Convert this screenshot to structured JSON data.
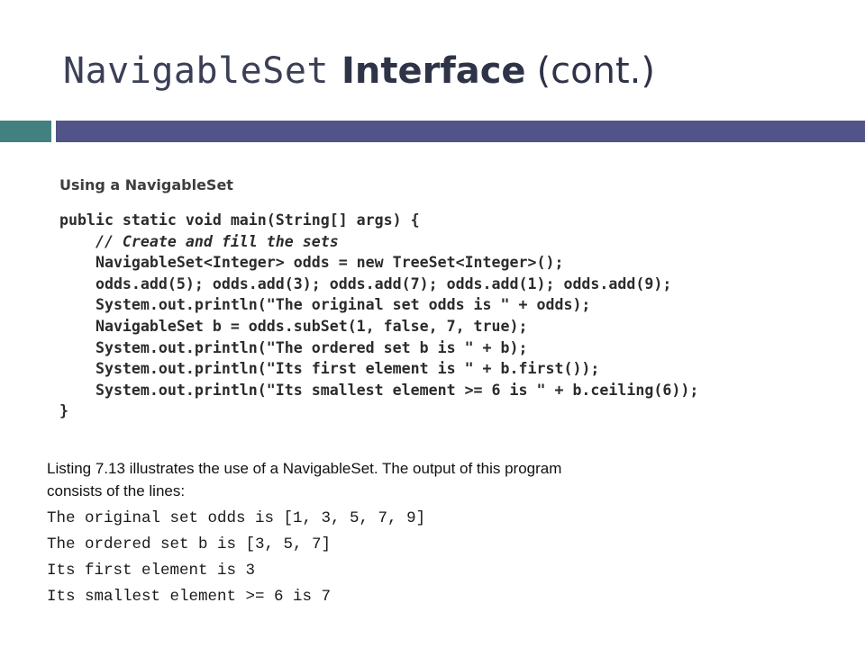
{
  "slide": {
    "title": {
      "mono_part": "NavigableSet",
      "bold_part": "Interface",
      "rest_part": "(cont.)"
    },
    "colors": {
      "title_text": "#3b3f56",
      "rule_teal": "#42817f",
      "rule_purple": "#515389",
      "code_text": "#2b2b2b",
      "body_text": "#111111"
    }
  },
  "figure": {
    "caption": "Using a NavigableSet",
    "code_lines": [
      {
        "text": "public static void main(String[] args) {",
        "comment": false
      },
      {
        "text": "    // Create and fill the sets",
        "comment": true
      },
      {
        "text": "    NavigableSet<Integer> odds = new TreeSet<Integer>();",
        "comment": false
      },
      {
        "text": "    odds.add(5); odds.add(3); odds.add(7); odds.add(1); odds.add(9);",
        "comment": false
      },
      {
        "text": "    System.out.println(\"The original set odds is \" + odds);",
        "comment": false
      },
      {
        "text": "    NavigableSet b = odds.subSet(1, false, 7, true);",
        "comment": false
      },
      {
        "text": "    System.out.println(\"The ordered set b is \" + b);",
        "comment": false
      },
      {
        "text": "    System.out.println(\"Its first element is \" + b.first());",
        "comment": false
      },
      {
        "text": "    System.out.println(\"Its smallest element >= 6 is \" + b.ceiling(6));",
        "comment": false
      },
      {
        "text": "}",
        "comment": false
      }
    ]
  },
  "body": {
    "paragraph_line_1": "Listing 7.13 illustrates the use of a NavigableSet. The output of this program",
    "paragraph_line_2": "consists of the lines:",
    "output_lines": [
      "The original set odds is [1, 3, 5, 7, 9]",
      "The ordered set b is [3, 5, 7]",
      "Its first element is 3",
      "Its smallest element >= 6 is 7"
    ]
  }
}
